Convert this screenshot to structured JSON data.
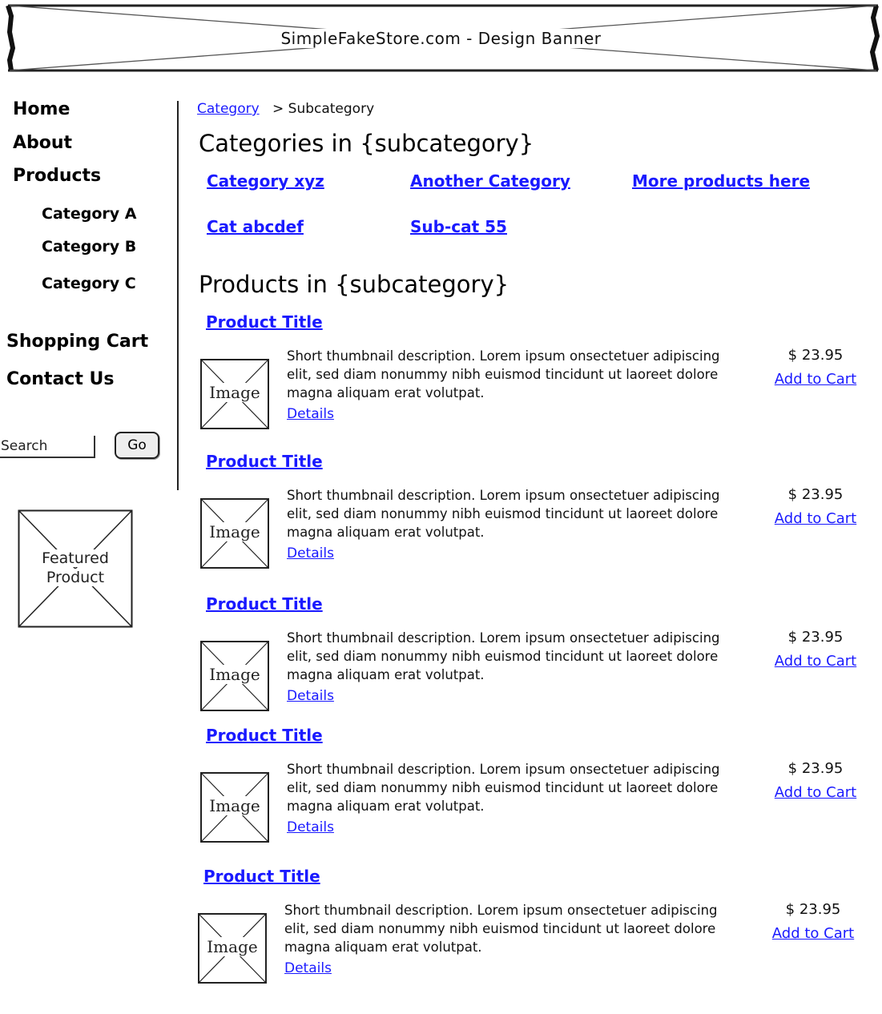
{
  "banner": {
    "title": "SimpleFakeStore.com  -  Design Banner"
  },
  "sidebar": {
    "nav": {
      "home": "Home",
      "about": "About",
      "products": "Products",
      "category_a": "Category A",
      "category_b": "Category B",
      "category_c": "Category C",
      "shopping_cart": "Shopping Cart",
      "contact_us": "Contact Us"
    },
    "search": {
      "placeholder": "Search",
      "button_label": "Go"
    },
    "featured": {
      "line1": "Featured",
      "line2": "Product"
    }
  },
  "breadcrumb": {
    "link": "Category",
    "current": "> Subcategory"
  },
  "categories": {
    "heading": "Categories in {subcategory}",
    "links": [
      "Category xyz",
      "Another Category",
      "More products here",
      "Cat abcdef",
      "Sub-cat 55"
    ]
  },
  "products": {
    "heading": "Products in {subcategory}",
    "items": [
      {
        "title": "Product Title",
        "image_label": "Image",
        "desc_line1": "Short thumbnail description. Lorem ipsum onsectetuer adipiscing",
        "desc_line2": "elit, sed diam nonummy nibh euismod tincidunt ut laoreet dolore",
        "desc_line3": "magna aliquam erat volutpat.",
        "details": "Details",
        "price": "$ 23.95",
        "add_to_cart": "Add to Cart"
      },
      {
        "title": "Product Title",
        "image_label": "Image",
        "desc_line1": "Short thumbnail description. Lorem ipsum onsectetuer adipiscing",
        "desc_line2": "elit, sed diam nonummy nibh euismod tincidunt ut laoreet dolore",
        "desc_line3": "magna aliquam erat volutpat.",
        "details": "Details",
        "price": "$ 23.95",
        "add_to_cart": "Add to Cart"
      },
      {
        "title": "Product Title",
        "image_label": "Image",
        "desc_line1": "Short thumbnail description. Lorem ipsum onsectetuer adipiscing",
        "desc_line2": "elit, sed diam nonummy nibh euismod tincidunt ut laoreet dolore",
        "desc_line3": "magna aliquam erat volutpat.",
        "details": "Details",
        "price": "$ 23.95",
        "add_to_cart": "Add to Cart"
      },
      {
        "title": "Product Title",
        "image_label": "Image",
        "desc_line1": "Short thumbnail description. Lorem ipsum onsectetuer adipiscing",
        "desc_line2": "elit, sed diam nonummy nibh euismod tincidunt ut laoreet dolore",
        "desc_line3": "magna aliquam erat volutpat.",
        "details": "Details",
        "price": "$ 23.95",
        "add_to_cart": "Add to Cart"
      },
      {
        "title": "Product Title",
        "image_label": "Image",
        "desc_line1": "Short thumbnail description. Lorem ipsum onsectetuer adipiscing",
        "desc_line2": "elit, sed diam nonummy nibh euismod tincidunt ut laoreet dolore",
        "desc_line3": "magna aliquam erat volutpat.",
        "details": "Details",
        "price": "$ 23.95",
        "add_to_cart": "Add to Cart"
      }
    ]
  }
}
